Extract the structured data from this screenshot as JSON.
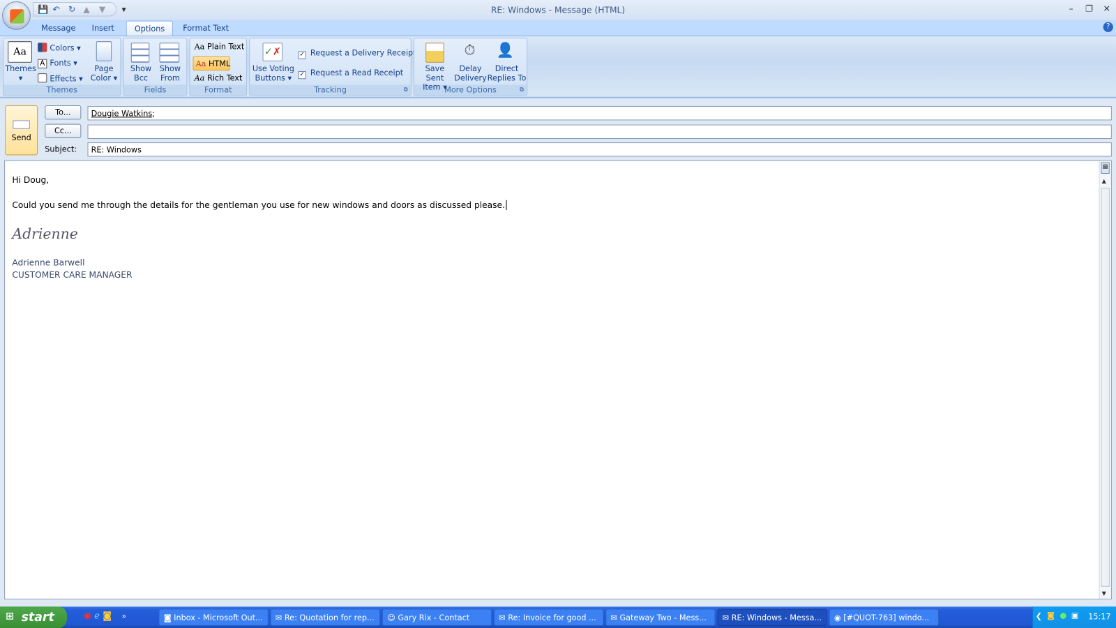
{
  "window": {
    "title": "RE: Windows - Message (HTML)"
  },
  "qat": {
    "icons": [
      "save-icon",
      "undo-icon",
      "redo-icon",
      "up-icon",
      "down-icon"
    ],
    "customize": "▾"
  },
  "tabs": [
    {
      "label": "Message"
    },
    {
      "label": "Insert"
    },
    {
      "label": "Options",
      "active": true
    },
    {
      "label": "Format Text"
    }
  ],
  "ribbon": {
    "themes": {
      "label": "Themes",
      "themes_btn": "Themes",
      "colors": "Colors",
      "fonts": "Fonts",
      "effects": "Effects",
      "page_color_1": "Page",
      "page_color_2": "Color"
    },
    "fields": {
      "label": "Fields",
      "show_bcc_1": "Show",
      "show_bcc_2": "Bcc",
      "show_from_1": "Show",
      "show_from_2": "From"
    },
    "format": {
      "label": "Format",
      "plain": "Plain Text",
      "html": "HTML",
      "rich": "Rich Text",
      "selected": "HTML"
    },
    "tracking": {
      "label": "Tracking",
      "voting_1": "Use Voting",
      "voting_2": "Buttons",
      "delivery": "Request a Delivery Receipt",
      "read": "Request a Read Receipt",
      "delivery_checked": true,
      "read_checked": true
    },
    "more": {
      "label": "More Options",
      "save_1": "Save Sent",
      "save_2": "Item",
      "delay_1": "Delay",
      "delay_2": "Delivery",
      "direct_1": "Direct",
      "direct_2": "Replies To"
    }
  },
  "header": {
    "send": "Send",
    "to_btn": "To...",
    "cc_btn": "Cc...",
    "subject_label": "Subject:",
    "to_value": "Dougie Watkins",
    "to_sep": ";",
    "cc_value": "",
    "subject_value": "RE: Windows"
  },
  "body": {
    "greeting": "Hi Doug,",
    "line1": "Could you send me through the details for the gentleman you use for new windows and doors as discussed please.",
    "signature": "Adrienne",
    "name": "Adrienne Barwell",
    "role": "CUSTOMER CARE MANAGER"
  },
  "taskbar": {
    "start": "start",
    "items": [
      {
        "label": "Inbox - Microsoft Out..."
      },
      {
        "label": "Re: Quotation for rep..."
      },
      {
        "label": "Gary Rix - Contact"
      },
      {
        "label": "Re: Invoice for good ..."
      },
      {
        "label": "Gateway Two - Mess..."
      },
      {
        "label": "RE: Windows - Messa...",
        "active": true
      },
      {
        "label": "[#QUOT-763] windo..."
      }
    ],
    "clock": "15:17"
  },
  "colors": {
    "ribbon": "#c5d9f1",
    "tabs": "#bfdbff",
    "taskbar": "#245edb",
    "send": "#ffe29a",
    "html_selected": "#ffc55a"
  }
}
